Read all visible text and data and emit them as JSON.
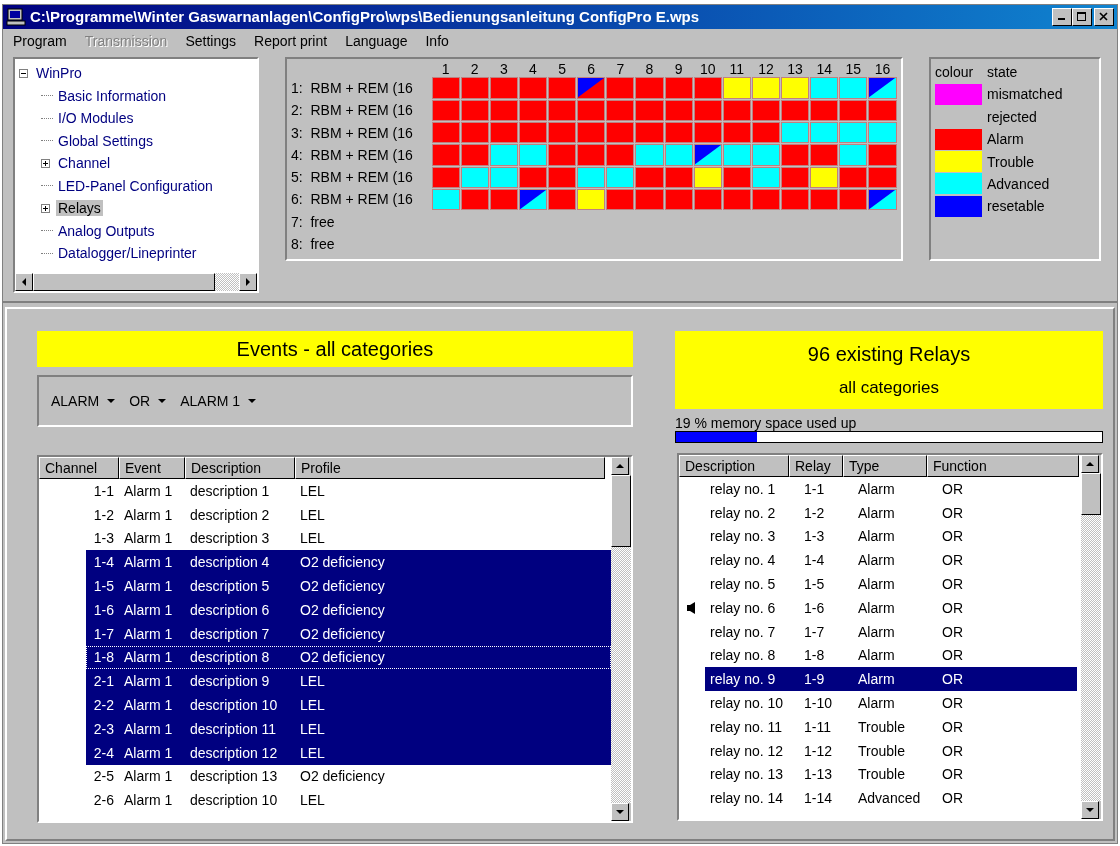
{
  "window": {
    "title": "C:\\Programme\\Winter Gaswarnanlagen\\ConfigPro\\wps\\Bedienungsanleitung ConfigPro E.wps"
  },
  "menu": [
    {
      "label": "Program",
      "disabled": false
    },
    {
      "label": "Transmission",
      "disabled": true
    },
    {
      "label": "Settings",
      "disabled": false
    },
    {
      "label": "Report print",
      "disabled": false
    },
    {
      "label": "Language",
      "disabled": false
    },
    {
      "label": "Info",
      "disabled": false
    }
  ],
  "tree": [
    {
      "label": "WinPro",
      "expanded": true,
      "selected": false,
      "children": [
        {
          "label": "Basic Information",
          "selected": false
        },
        {
          "label": "I/O Modules",
          "selected": false
        },
        {
          "label": "Global Settings",
          "selected": false
        },
        {
          "label": "Channel",
          "expanded": false,
          "selected": false
        },
        {
          "label": "LED-Panel Configuration",
          "selected": false
        },
        {
          "label": "Relays",
          "expanded": false,
          "selected": true
        },
        {
          "label": "Analog Outputs",
          "selected": false
        },
        {
          "label": "Datalogger/Lineprinter",
          "selected": false
        }
      ]
    }
  ],
  "relay_grid": {
    "columns": [
      "1",
      "2",
      "3",
      "4",
      "5",
      "6",
      "7",
      "8",
      "9",
      "10",
      "11",
      "12",
      "13",
      "14",
      "15",
      "16"
    ],
    "rows": [
      {
        "label": "1:  RBM + REM (16",
        "cells": [
          {
            "color": "#ff0000",
            "resetable": false
          },
          {
            "color": "#ff0000",
            "resetable": false
          },
          {
            "color": "#ff0000",
            "resetable": false
          },
          {
            "color": "#ff0000",
            "resetable": false
          },
          {
            "color": "#ff0000",
            "resetable": false
          },
          {
            "color": "#ff0000",
            "resetable": true
          },
          {
            "color": "#ff0000",
            "resetable": false
          },
          {
            "color": "#ff0000",
            "resetable": false
          },
          {
            "color": "#ff0000",
            "resetable": false
          },
          {
            "color": "#ff0000",
            "resetable": false
          },
          {
            "color": "#ffff00",
            "resetable": false
          },
          {
            "color": "#ffff00",
            "resetable": false
          },
          {
            "color": "#ffff00",
            "resetable": false
          },
          {
            "color": "#00ffff",
            "resetable": false
          },
          {
            "color": "#00ffff",
            "resetable": false
          },
          {
            "color": "#00ffff",
            "resetable": true
          }
        ]
      },
      {
        "label": "2:  RBM + REM (16",
        "cells": [
          {
            "color": "#ff0000",
            "resetable": false
          },
          {
            "color": "#ff0000",
            "resetable": false
          },
          {
            "color": "#ff0000",
            "resetable": false
          },
          {
            "color": "#ff0000",
            "resetable": false
          },
          {
            "color": "#ff0000",
            "resetable": false
          },
          {
            "color": "#ff0000",
            "resetable": false
          },
          {
            "color": "#ff0000",
            "resetable": false
          },
          {
            "color": "#ff0000",
            "resetable": false
          },
          {
            "color": "#ff0000",
            "resetable": false
          },
          {
            "color": "#ff0000",
            "resetable": false
          },
          {
            "color": "#ff0000",
            "resetable": false
          },
          {
            "color": "#ff0000",
            "resetable": false
          },
          {
            "color": "#ff0000",
            "resetable": false
          },
          {
            "color": "#ff0000",
            "resetable": false
          },
          {
            "color": "#ff0000",
            "resetable": false
          },
          {
            "color": "#ff0000",
            "resetable": false
          }
        ]
      },
      {
        "label": "3:  RBM + REM (16",
        "cells": [
          {
            "color": "#ff0000",
            "resetable": false
          },
          {
            "color": "#ff0000",
            "resetable": false
          },
          {
            "color": "#ff0000",
            "resetable": false
          },
          {
            "color": "#ff0000",
            "resetable": false
          },
          {
            "color": "#ff0000",
            "resetable": false
          },
          {
            "color": "#ff0000",
            "resetable": false
          },
          {
            "color": "#ff0000",
            "resetable": false
          },
          {
            "color": "#ff0000",
            "resetable": false
          },
          {
            "color": "#ff0000",
            "resetable": false
          },
          {
            "color": "#ff0000",
            "resetable": false
          },
          {
            "color": "#ff0000",
            "resetable": false
          },
          {
            "color": "#ff0000",
            "resetable": false
          },
          {
            "color": "#00ffff",
            "resetable": false
          },
          {
            "color": "#00ffff",
            "resetable": false
          },
          {
            "color": "#00ffff",
            "resetable": false
          },
          {
            "color": "#00ffff",
            "resetable": false
          }
        ]
      },
      {
        "label": "4:  RBM + REM (16",
        "cells": [
          {
            "color": "#ff0000",
            "resetable": false
          },
          {
            "color": "#ff0000",
            "resetable": false
          },
          {
            "color": "#00ffff",
            "resetable": false
          },
          {
            "color": "#00ffff",
            "resetable": false
          },
          {
            "color": "#ff0000",
            "resetable": false
          },
          {
            "color": "#ff0000",
            "resetable": false
          },
          {
            "color": "#ff0000",
            "resetable": false
          },
          {
            "color": "#00ffff",
            "resetable": false
          },
          {
            "color": "#00ffff",
            "resetable": false
          },
          {
            "color": "#00ffff",
            "resetable": true
          },
          {
            "color": "#00ffff",
            "resetable": false
          },
          {
            "color": "#00ffff",
            "resetable": false
          },
          {
            "color": "#ff0000",
            "resetable": false
          },
          {
            "color": "#ff0000",
            "resetable": false
          },
          {
            "color": "#00ffff",
            "resetable": false
          },
          {
            "color": "#ff0000",
            "resetable": false
          }
        ]
      },
      {
        "label": "5:  RBM + REM (16",
        "cells": [
          {
            "color": "#ff0000",
            "resetable": false
          },
          {
            "color": "#00ffff",
            "resetable": false
          },
          {
            "color": "#00ffff",
            "resetable": false
          },
          {
            "color": "#ff0000",
            "resetable": false
          },
          {
            "color": "#ff0000",
            "resetable": false
          },
          {
            "color": "#00ffff",
            "resetable": false
          },
          {
            "color": "#00ffff",
            "resetable": false
          },
          {
            "color": "#ff0000",
            "resetable": false
          },
          {
            "color": "#ff0000",
            "resetable": false
          },
          {
            "color": "#ffff00",
            "resetable": false
          },
          {
            "color": "#ff0000",
            "resetable": false
          },
          {
            "color": "#00ffff",
            "resetable": false
          },
          {
            "color": "#ff0000",
            "resetable": false
          },
          {
            "color": "#ffff00",
            "resetable": false
          },
          {
            "color": "#ff0000",
            "resetable": false
          },
          {
            "color": "#ff0000",
            "resetable": false
          }
        ]
      },
      {
        "label": "6:  RBM + REM (16",
        "cells": [
          {
            "color": "#00ffff",
            "resetable": false
          },
          {
            "color": "#ff0000",
            "resetable": false
          },
          {
            "color": "#ff0000",
            "resetable": false
          },
          {
            "color": "#00ffff",
            "resetable": true
          },
          {
            "color": "#ff0000",
            "resetable": false
          },
          {
            "color": "#ffff00",
            "resetable": false
          },
          {
            "color": "#ff0000",
            "resetable": false
          },
          {
            "color": "#ff0000",
            "resetable": false
          },
          {
            "color": "#ff0000",
            "resetable": false
          },
          {
            "color": "#ff0000",
            "resetable": false
          },
          {
            "color": "#ff0000",
            "resetable": false
          },
          {
            "color": "#ff0000",
            "resetable": false
          },
          {
            "color": "#ff0000",
            "resetable": false
          },
          {
            "color": "#ff0000",
            "resetable": false
          },
          {
            "color": "#ff0000",
            "resetable": false
          },
          {
            "color": "#00ffff",
            "resetable": true
          }
        ]
      },
      {
        "label": "7:  free",
        "cells": []
      },
      {
        "label": "8:  free",
        "cells": []
      }
    ]
  },
  "legend": {
    "headers": [
      "colour",
      "state"
    ],
    "items": [
      {
        "label": "mismatched",
        "color": "#ff00ff"
      },
      {
        "label": "rejected"
      },
      {
        "label": "Alarm",
        "color": "#ff0000"
      },
      {
        "label": "Trouble",
        "color": "#ffff00"
      },
      {
        "label": "Advanced",
        "color": "#00ffff"
      },
      {
        "label": "resetable",
        "color": "#0000ff"
      }
    ]
  },
  "events": {
    "title": "Events - all categories",
    "filters": [
      "ALARM",
      "OR",
      "ALARM 1"
    ],
    "columns": [
      "Channel",
      "Event",
      "Description",
      "Profile"
    ],
    "rows": [
      {
        "channel": "1-1",
        "event": "Alarm 1",
        "description": "description 1",
        "profile": "LEL",
        "selected": false,
        "focused": false
      },
      {
        "channel": "1-2",
        "event": "Alarm 1",
        "description": "description 2",
        "profile": "LEL",
        "selected": false,
        "focused": false
      },
      {
        "channel": "1-3",
        "event": "Alarm 1",
        "description": "description 3",
        "profile": "LEL",
        "selected": false,
        "focused": false
      },
      {
        "channel": "1-4",
        "event": "Alarm 1",
        "description": "description 4",
        "profile": "O2 deficiency",
        "selected": true,
        "focused": false
      },
      {
        "channel": "1-5",
        "event": "Alarm 1",
        "description": "description 5",
        "profile": "O2 deficiency",
        "selected": true,
        "focused": false
      },
      {
        "channel": "1-6",
        "event": "Alarm 1",
        "description": "description 6",
        "profile": "O2 deficiency",
        "selected": true,
        "focused": false
      },
      {
        "channel": "1-7",
        "event": "Alarm 1",
        "description": "description 7",
        "profile": "O2 deficiency",
        "selected": true,
        "focused": false
      },
      {
        "channel": "1-8",
        "event": "Alarm 1",
        "description": "description 8",
        "profile": "O2 deficiency",
        "selected": true,
        "focused": true
      },
      {
        "channel": "2-1",
        "event": "Alarm 1",
        "description": "description 9",
        "profile": "LEL",
        "selected": true,
        "focused": false
      },
      {
        "channel": "2-2",
        "event": "Alarm 1",
        "description": "description 10",
        "profile": "LEL",
        "selected": true,
        "focused": false
      },
      {
        "channel": "2-3",
        "event": "Alarm 1",
        "description": "description 11",
        "profile": "LEL",
        "selected": true,
        "focused": false
      },
      {
        "channel": "2-4",
        "event": "Alarm 1",
        "description": "description 12",
        "profile": "LEL",
        "selected": true,
        "focused": false
      },
      {
        "channel": "2-5",
        "event": "Alarm 1",
        "description": "description 13",
        "profile": "O2 deficiency",
        "selected": false,
        "focused": false
      },
      {
        "channel": "2-6",
        "event": "Alarm 1",
        "description": "description 10",
        "profile": "LEL",
        "selected": false,
        "focused": false
      }
    ]
  },
  "relays": {
    "title": "96 existing Relays",
    "subtitle": "all categories",
    "memory": {
      "label": "19 % memory space used up",
      "level": 0.19
    },
    "columns": [
      "Description",
      "Relay",
      "Type",
      "Function"
    ],
    "rows": [
      {
        "description": "relay no. 1",
        "relay": "1-1",
        "type": "Alarm",
        "function": "OR",
        "selected": false,
        "marked": false
      },
      {
        "description": "relay no. 2",
        "relay": "1-2",
        "type": "Alarm",
        "function": "OR",
        "selected": false,
        "marked": false
      },
      {
        "description": "relay no. 3",
        "relay": "1-3",
        "type": "Alarm",
        "function": "OR",
        "selected": false,
        "marked": false
      },
      {
        "description": "relay no. 4",
        "relay": "1-4",
        "type": "Alarm",
        "function": "OR",
        "selected": false,
        "marked": false
      },
      {
        "description": "relay no. 5",
        "relay": "1-5",
        "type": "Alarm",
        "function": "OR",
        "selected": false,
        "marked": false
      },
      {
        "description": "relay no. 6",
        "relay": "1-6",
        "type": "Alarm",
        "function": "OR",
        "selected": false,
        "marked": true
      },
      {
        "description": "relay no. 7",
        "relay": "1-7",
        "type": "Alarm",
        "function": "OR",
        "selected": false,
        "marked": false
      },
      {
        "description": "relay no. 8",
        "relay": "1-8",
        "type": "Alarm",
        "function": "OR",
        "selected": false,
        "marked": false
      },
      {
        "description": "relay no. 9",
        "relay": "1-9",
        "type": "Alarm",
        "function": "OR",
        "selected": true,
        "marked": false
      },
      {
        "description": "relay no. 10",
        "relay": "1-10",
        "type": "Alarm",
        "function": "OR",
        "selected": false,
        "marked": false
      },
      {
        "description": "relay no. 11",
        "relay": "1-11",
        "type": "Trouble",
        "function": "OR",
        "selected": false,
        "marked": false
      },
      {
        "description": "relay no. 12",
        "relay": "1-12",
        "type": "Trouble",
        "function": "OR",
        "selected": false,
        "marked": false
      },
      {
        "description": "relay no. 13",
        "relay": "1-13",
        "type": "Trouble",
        "function": "OR",
        "selected": false,
        "marked": false
      },
      {
        "description": "relay no. 14",
        "relay": "1-14",
        "type": "Advanced",
        "function": "OR",
        "selected": false,
        "marked": false
      }
    ]
  }
}
